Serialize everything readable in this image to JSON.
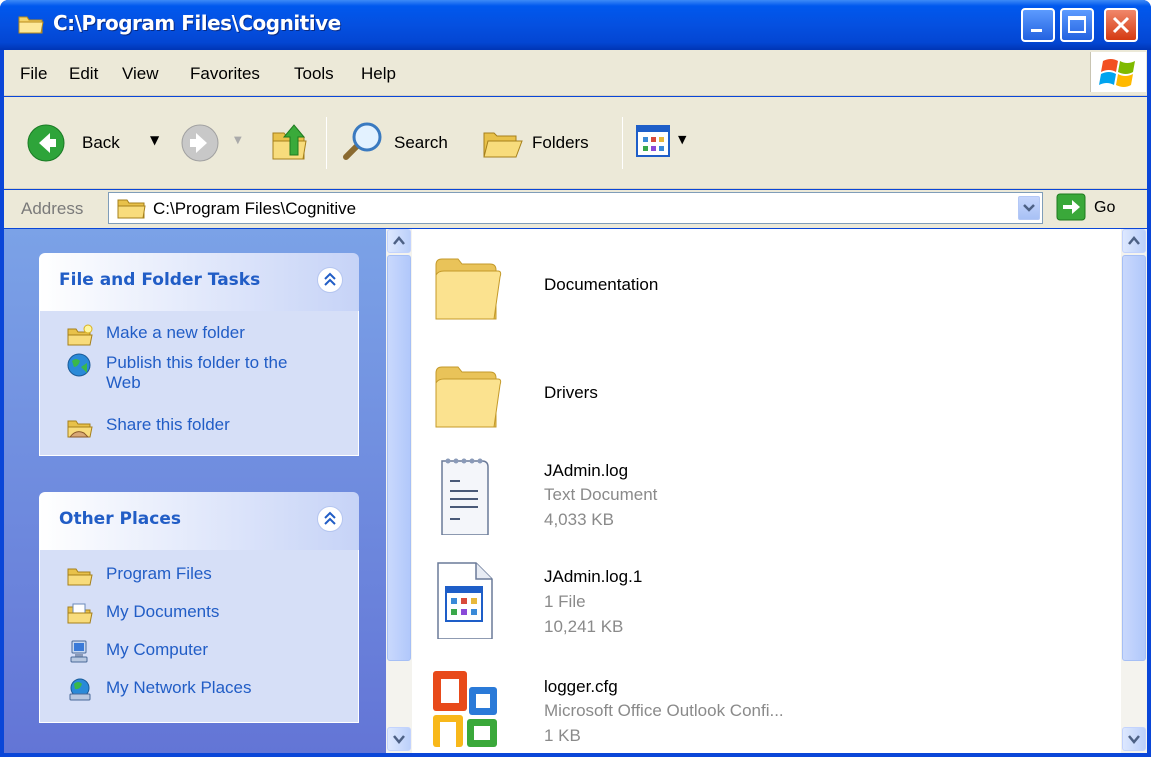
{
  "window": {
    "title": "C:\\Program Files\\Cognitive"
  },
  "menu": [
    "File",
    "Edit",
    "View",
    "Favorites",
    "Tools",
    "Help"
  ],
  "toolbar": {
    "back_label": "Back",
    "search_label": "Search",
    "folders_label": "Folders"
  },
  "address": {
    "label": "Address",
    "value": "C:\\Program Files\\Cognitive",
    "go_label": "Go"
  },
  "tasks_panel": {
    "title": "File and Folder Tasks",
    "items": [
      {
        "label": "Make a new folder",
        "icon": "new-folder-icon"
      },
      {
        "label": "Publish this folder to the Web",
        "icon": "publish-web-icon"
      },
      {
        "label": "Share this folder",
        "icon": "share-folder-icon"
      }
    ]
  },
  "places_panel": {
    "title": "Other Places",
    "items": [
      {
        "label": "Program Files",
        "icon": "folder-icon"
      },
      {
        "label": "My Documents",
        "icon": "my-documents-icon"
      },
      {
        "label": "My Computer",
        "icon": "my-computer-icon"
      },
      {
        "label": "My Network Places",
        "icon": "network-places-icon"
      }
    ]
  },
  "files": [
    {
      "name": "Documentation",
      "type": "",
      "size": "",
      "icon": "folder-icon"
    },
    {
      "name": "Drivers",
      "type": "",
      "size": "",
      "icon": "folder-icon"
    },
    {
      "name": "JAdmin.log",
      "type": "Text Document",
      "size": "4,033 KB",
      "icon": "text-document-icon"
    },
    {
      "name": "JAdmin.log.1",
      "type": "1 File",
      "size": "10,241 KB",
      "icon": "generic-file-icon"
    },
    {
      "name": "logger.cfg",
      "type": "Microsoft Office Outlook Confi...",
      "size": "1 KB",
      "icon": "office-outlook-icon"
    }
  ],
  "colors": {
    "titlebar": "#0058ee",
    "link": "#215dc6",
    "chrome": "#ece9d8",
    "taskpane": "#7ba2e7"
  }
}
